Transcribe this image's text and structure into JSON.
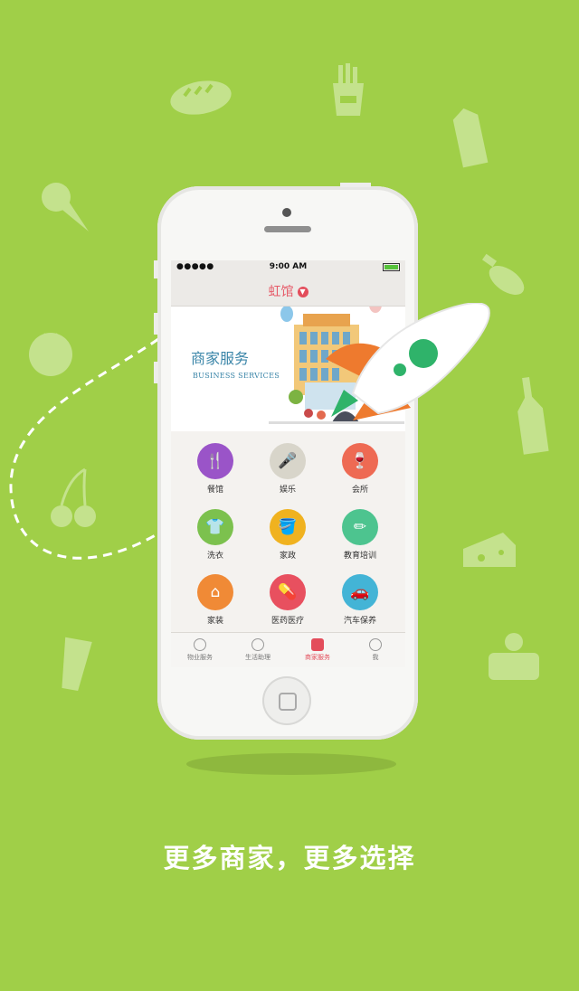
{
  "status_bar": {
    "signal": "●●●●● ",
    "time": "9:00 AM"
  },
  "nav": {
    "title": "虹馆",
    "dropdown_icon": "chevron-down-icon"
  },
  "banner": {
    "title_cn": "商家服务",
    "title_en": "BUSINESS SERVICES"
  },
  "categories": [
    {
      "label": "餐馆",
      "icon": "restaurant-icon",
      "color": "#9a54c8"
    },
    {
      "label": "娱乐",
      "icon": "microphone-icon",
      "color": "#d8d5ca"
    },
    {
      "label": "会所",
      "icon": "wine-icon",
      "color": "#ee6a53"
    },
    {
      "label": "洗衣",
      "icon": "shirt-icon",
      "color": "#7cc14e"
    },
    {
      "label": "家政",
      "icon": "bucket-icon",
      "color": "#f0b21f"
    },
    {
      "label": "教育培训",
      "icon": "pencil-icon",
      "color": "#4dc48f"
    },
    {
      "label": "家装",
      "icon": "house-icon",
      "color": "#f08a36"
    },
    {
      "label": "医药医疗",
      "icon": "pill-icon",
      "color": "#e8505f"
    },
    {
      "label": "汽车保养",
      "icon": "car-icon",
      "color": "#43b4d6"
    }
  ],
  "tabs": [
    {
      "label": "物业服务",
      "active": false
    },
    {
      "label": "生活助理",
      "active": false
    },
    {
      "label": "商家服务",
      "active": true
    },
    {
      "label": "我",
      "active": false
    }
  ],
  "caption": "更多商家，更多选择",
  "colors": {
    "background": "#a0cf48",
    "accent": "#e34d5b"
  }
}
